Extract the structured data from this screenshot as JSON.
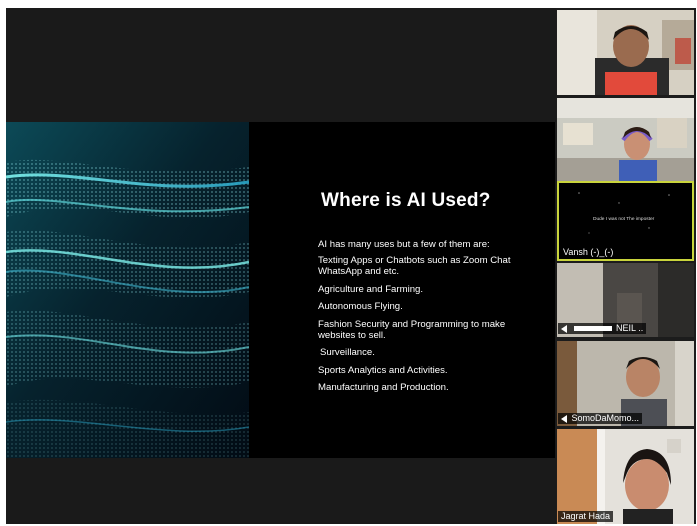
{
  "slide": {
    "title": "Where is AI Used?",
    "intro": "AI has many uses but a few of them are:",
    "bullets": [
      "Texting Apps or Chatbots such as Zoom Chat WhatsApp and etc.",
      "Agriculture and Farming.",
      "Autonomous Flying.",
      "Fashion Security and    Programming to make websites to sell.",
      " Surveillance.",
      "Sports Analytics and Activities.",
      "Manufacturing and Production."
    ]
  },
  "participants": [
    {
      "name": "",
      "tile_color": "#d8d2c6"
    },
    {
      "name": "",
      "tile_color": "#cfd0c7"
    },
    {
      "name": "Vansh (-)_(-)",
      "message": "Dude I was not The imposter",
      "speaking": true
    },
    {
      "name": "NEIL ..",
      "muted": true
    },
    {
      "name": "SomoDaMomo...",
      "muted": true
    },
    {
      "name": "Jagrat Hada"
    }
  ],
  "colors": {
    "background": "#1c1c1c",
    "slide_background": "#000000",
    "active_speaker_border": "#c9d43c",
    "slide_wave": "#3fd6d8"
  }
}
